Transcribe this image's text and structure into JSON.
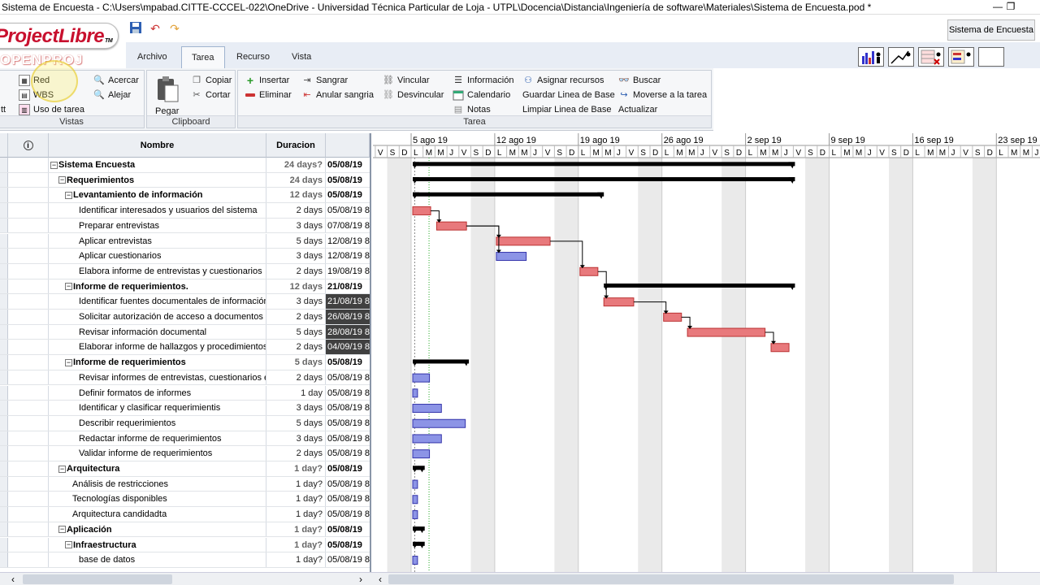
{
  "window": {
    "title": "Sistema de Encuesta - C:\\Users\\mpabad.CITTE-CCCEL-022\\OneDrive - Universidad Técnica Particular de Loja - UTPL\\Docencia\\Distancia\\Ingeniería de software\\Materiales\\Sistema de Encuesta.pod *",
    "minimize": "—",
    "restore": "❐"
  },
  "logo": {
    "brand": "ProjectLibre",
    "tm": "TM",
    "sub": "OPENPROJ"
  },
  "project_name": "Sistema de Encuesta",
  "tabs": [
    {
      "label": "Archivo"
    },
    {
      "label": "Tarea"
    },
    {
      "label": "Recurso"
    },
    {
      "label": "Vista"
    }
  ],
  "ribbon": {
    "vistas": {
      "label": "Vistas",
      "gantt": "tt",
      "red": "Red",
      "wbs": "WBS",
      "uso": "Uso de tarea",
      "acercar": "Acercar",
      "alejar": "Alejar"
    },
    "clipboard": {
      "label": "Clipboard",
      "pegar": "Pegar",
      "copiar": "Copiar",
      "cortar": "Cortar"
    },
    "tarea": {
      "label": "Tarea",
      "insertar": "Insertar",
      "eliminar": "Eliminar",
      "sangrar": "Sangrar",
      "anular": "Anular sangria",
      "vincular": "Vincular",
      "desvincular": "Desvincular",
      "informacion": "Información",
      "calendario": "Calendario",
      "notas": "Notas",
      "asignar": "Asignar recursos",
      "guardar": "Guardar Linea de Base",
      "limpiar": "Limpiar Linea de Base",
      "buscar": "Buscar",
      "moverse": "Moverse a la tarea",
      "actualizar": "Actualizar"
    }
  },
  "table": {
    "headers": {
      "nombre": "Nombre",
      "duracion": "Duracion"
    },
    "rows": [
      {
        "name": "Sistema Encuesta",
        "dur": "24 days?",
        "start": "05/08/19",
        "level": 0,
        "summary": true
      },
      {
        "name": "Requerimientos",
        "dur": "24 days",
        "start": "05/08/19",
        "level": 1,
        "summary": true
      },
      {
        "name": "Levantamiento de información",
        "dur": "12 days",
        "start": "05/08/19",
        "level": 2,
        "summary": true
      },
      {
        "name": "Identificar interesados y usuarios del sistema",
        "dur": "2 days",
        "start": "05/08/19 8",
        "level": 3
      },
      {
        "name": "Preparar entrevistas",
        "dur": "3 days",
        "start": "07/08/19 8",
        "level": 3
      },
      {
        "name": "Aplicar entrevistas",
        "dur": "5 days",
        "start": "12/08/19 8",
        "level": 3
      },
      {
        "name": "Aplicar cuestionarios",
        "dur": "3 days",
        "start": "12/08/19 8",
        "level": 3
      },
      {
        "name": "Elabora informe de entrevistas y cuestionarios",
        "dur": "2 days",
        "start": "19/08/19 8",
        "level": 3
      },
      {
        "name": "Informe de requerimientos.",
        "dur": "12 days",
        "start": "21/08/19",
        "level": 2,
        "summary": true
      },
      {
        "name": "Identificar fuentes documentales de información",
        "dur": "3 days",
        "start": "21/08/19 8",
        "level": 3,
        "sel": true
      },
      {
        "name": "Solicitar autorización de acceso a documentos",
        "dur": "2 days",
        "start": "26/08/19 8",
        "level": 3,
        "sel": true
      },
      {
        "name": "Revisar información documental",
        "dur": "5 days",
        "start": "28/08/19 8",
        "level": 3,
        "sel": true
      },
      {
        "name": "Elaborar informe de hallazgos y procedimientos id",
        "dur": "2 days",
        "start": "04/09/19 8",
        "level": 3,
        "sel": true
      },
      {
        "name": "Informe de requerimientos",
        "dur": "5 days",
        "start": "05/08/19",
        "level": 2,
        "summary": true
      },
      {
        "name": "Revisar informes de entrevistas, cuestionarios e",
        "dur": "2 days",
        "start": "05/08/19 8",
        "level": 3
      },
      {
        "name": "Definir formatos de informes",
        "dur": "1 day",
        "start": "05/08/19 8",
        "level": 3
      },
      {
        "name": "Identificar y clasificar requerimientis",
        "dur": "3 days",
        "start": "05/08/19 8",
        "level": 3
      },
      {
        "name": "Describir requerimientos",
        "dur": "5 days",
        "start": "05/08/19 8",
        "level": 3
      },
      {
        "name": "Redactar informe de requerimientos",
        "dur": "3 days",
        "start": "05/08/19 8",
        "level": 3
      },
      {
        "name": "Validar informe de requerimientos",
        "dur": "2 days",
        "start": "05/08/19 8",
        "level": 3
      },
      {
        "name": "Arquitectura",
        "dur": "1 day?",
        "start": "05/08/19",
        "level": 1,
        "summary": true
      },
      {
        "name": "Análisis de restricciones",
        "dur": "1 day?",
        "start": "05/08/19 8",
        "level": 2
      },
      {
        "name": "Tecnologías disponibles",
        "dur": "1 day?",
        "start": "05/08/19 8",
        "level": 2
      },
      {
        "name": "Arquitectura candidadta",
        "dur": "1 day?",
        "start": "05/08/19 8",
        "level": 2
      },
      {
        "name": "Aplicación",
        "dur": "1 day?",
        "start": "05/08/19",
        "level": 1,
        "summary": true
      },
      {
        "name": "Infraestructura",
        "dur": "1 day?",
        "start": "05/08/19",
        "level": 2,
        "summary": true
      },
      {
        "name": "base de datos",
        "dur": "1 day?",
        "start": "05/08/19 8",
        "level": 3
      }
    ]
  },
  "gantt": {
    "weeks": [
      "5 ago 19",
      "12 ago 19",
      "19 ago 19",
      "26 ago 19",
      "2 sep 19",
      "9 sep 19",
      "16 sep 19",
      "23 sep 19"
    ],
    "day_letters": [
      "L",
      "M",
      "M",
      "J",
      "V",
      "S",
      "D"
    ],
    "first_day_letters": [
      "V",
      "S",
      "D"
    ],
    "bars": [
      {
        "type": "summary",
        "start": 0,
        "dur": 32
      },
      {
        "type": "summary",
        "start": 0,
        "dur": 32
      },
      {
        "type": "summary",
        "start": 0,
        "dur": 16
      },
      {
        "type": "critical",
        "start": 0,
        "dur": 1.5
      },
      {
        "type": "critical",
        "start": 2,
        "dur": 2.5
      },
      {
        "type": "critical",
        "start": 7,
        "dur": 4.5
      },
      {
        "type": "normal",
        "start": 7,
        "dur": 2.5
      },
      {
        "type": "critical",
        "start": 14,
        "dur": 1.5
      },
      {
        "type": "summary",
        "start": 16,
        "dur": 16
      },
      {
        "type": "critical",
        "start": 16,
        "dur": 2.5
      },
      {
        "type": "critical",
        "start": 21,
        "dur": 1.5
      },
      {
        "type": "critical",
        "start": 23,
        "dur": 6.5
      },
      {
        "type": "critical",
        "start": 30,
        "dur": 1.5
      },
      {
        "type": "summary",
        "start": 0,
        "dur": 4.7
      },
      {
        "type": "normal",
        "start": 0,
        "dur": 1.4
      },
      {
        "type": "normal",
        "start": 0,
        "dur": 0.4
      },
      {
        "type": "normal",
        "start": 0,
        "dur": 2.4
      },
      {
        "type": "normal",
        "start": 0,
        "dur": 4.4
      },
      {
        "type": "normal",
        "start": 0,
        "dur": 2.4
      },
      {
        "type": "normal",
        "start": 0,
        "dur": 1.4
      },
      {
        "type": "summary",
        "start": 0,
        "dur": 1
      },
      {
        "type": "normal",
        "start": 0,
        "dur": 0.4
      },
      {
        "type": "normal",
        "start": 0,
        "dur": 0.4
      },
      {
        "type": "normal",
        "start": 0,
        "dur": 0.4
      },
      {
        "type": "summary",
        "start": 0,
        "dur": 1
      },
      {
        "type": "summary",
        "start": 0,
        "dur": 1
      },
      {
        "type": "normal",
        "start": 0,
        "dur": 0.4
      }
    ],
    "links": [
      [
        3,
        4
      ],
      [
        4,
        5
      ],
      [
        4,
        6
      ],
      [
        5,
        7
      ],
      [
        7,
        9
      ],
      [
        9,
        10
      ],
      [
        10,
        11
      ],
      [
        11,
        12
      ]
    ],
    "colors": {
      "critical": "#e8797c",
      "normal": "#8c94e6",
      "summary": "#000000",
      "weekend": "#eaeaea"
    }
  },
  "scroll": {
    "left": "‹",
    "right": "›"
  }
}
